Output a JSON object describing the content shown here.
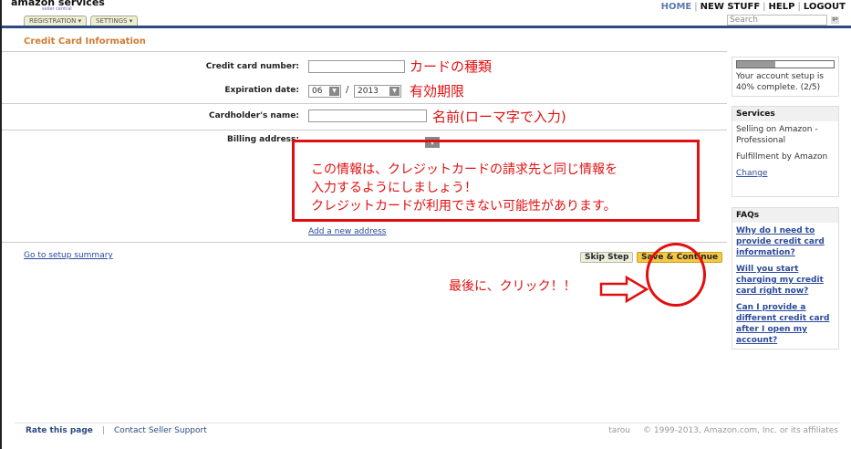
{
  "header": {
    "logo": "amazon services",
    "logo_sub": "seller central",
    "tabs": [
      "REGISTRATION ▾",
      "SETTINGS ▾"
    ],
    "nav": [
      "HOME",
      "NEW STUFF",
      "HELP",
      "LOGOUT"
    ],
    "search_placeholder": "Search",
    "go": "go"
  },
  "page_title": "Credit Card Information",
  "form": {
    "card_number_label": "Credit card number:",
    "card_number_value": "",
    "exp_label": "Expiration date:",
    "exp_month": "06",
    "exp_sep": "/",
    "exp_year": "2013",
    "name_label": "Cardholder's name:",
    "name_value": "",
    "billing_label": "Billing address:",
    "add_address": "Add a new address"
  },
  "annotations": {
    "card_type": "カードの種類",
    "expiry": "有効期限",
    "name": "名前(ローマ字で入力)",
    "note_lines": [
      "この情報は、クレジットカードの請求先と同じ情報を",
      "入力するようにしましょう！",
      "クレジットカードが利用できない可能性があります。"
    ],
    "click": "最後に、クリック！！"
  },
  "actions": {
    "setup_summary": "Go to setup summary",
    "skip": "Skip Step",
    "save": "Save & Continue"
  },
  "sidebar": {
    "progress": 40,
    "progress_text": "Your account setup is 40% complete. (2/5)",
    "services_title": "Services",
    "services": [
      "Selling on Amazon - Professional",
      "Fulfillment by Amazon"
    ],
    "change": "Change",
    "faqs_title": "FAQs",
    "faqs": [
      "Why do I need to provide credit card information?",
      "Will you start charging my credit card right now?",
      "Can I provide a different credit card after I open my account?"
    ]
  },
  "footer": {
    "rate": "Rate this page",
    "sep": "|",
    "contact": "Contact Seller Support",
    "user": "tarou",
    "copyright": "© 1999-2013, Amazon.com, Inc. or its affiliates"
  },
  "colors": {
    "accent": "#d07a30",
    "annotation": "#e01010",
    "link": "#2a4a9a"
  }
}
